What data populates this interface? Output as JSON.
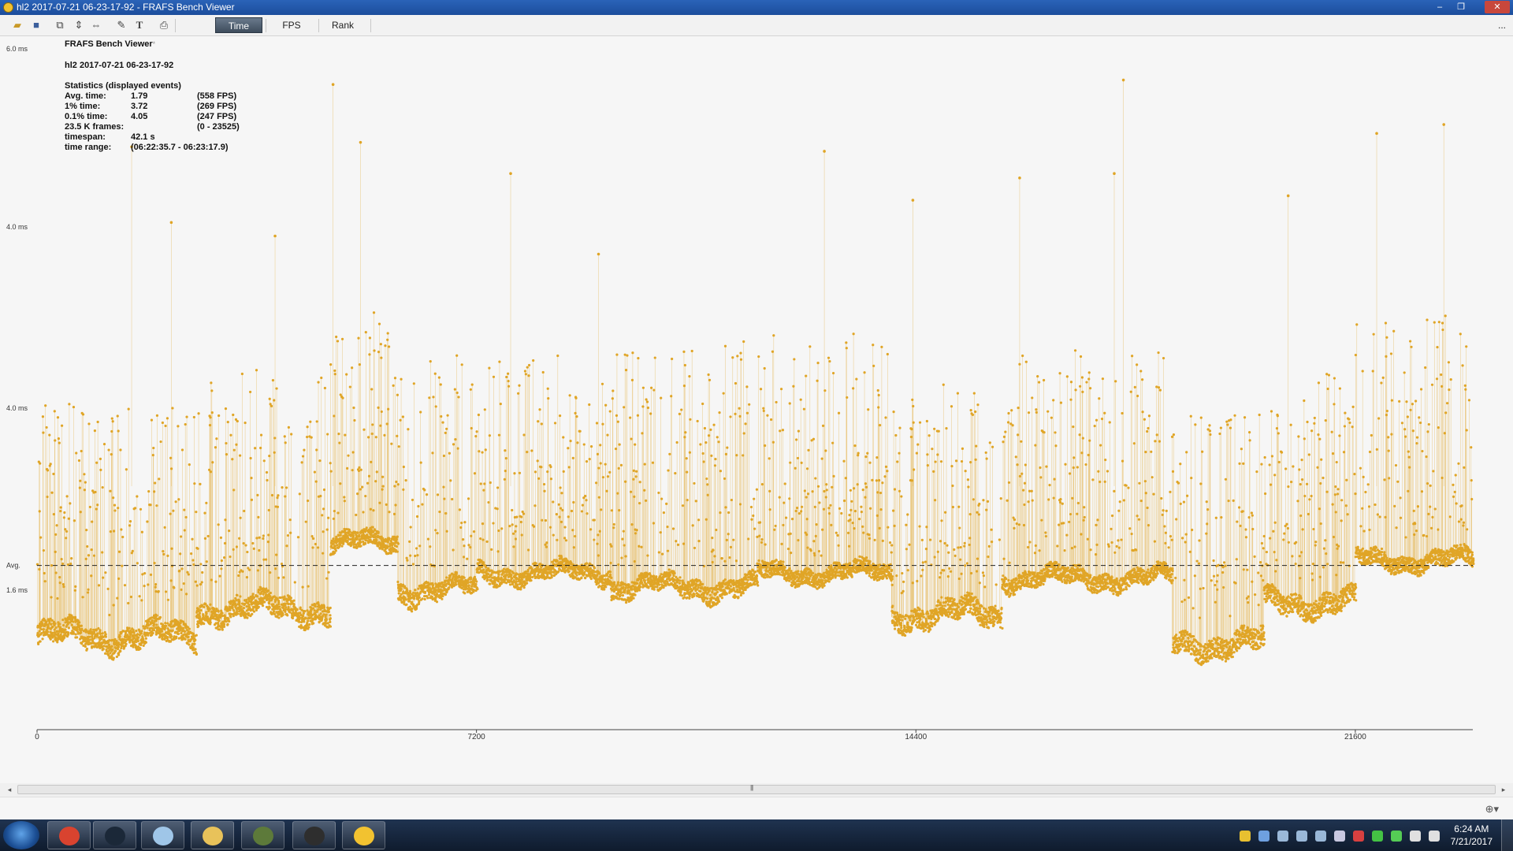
{
  "window": {
    "title": "hl2 2017-07-21 06-23-17-92 - FRAFS Bench Viewer",
    "controls": {
      "minimize": "–",
      "restore": "❐",
      "close": "✕"
    }
  },
  "toolbar": {
    "icons": [
      "open-folder-icon",
      "save-icon",
      "copy-icon",
      "fit-vertical-icon",
      "fit-horizontal-icon",
      "wrench-icon",
      "text-icon",
      "print-icon"
    ],
    "tabs": [
      {
        "label": "Time",
        "active": true
      },
      {
        "label": "FPS",
        "active": false
      },
      {
        "label": "Rank",
        "active": false
      }
    ],
    "overflow": "..."
  },
  "stats": {
    "app_name": "FRAFS Bench Viewer",
    "app_name_mark": "*",
    "file_name": "hl2 2017-07-21 06-23-17-92",
    "section_title": "Statistics (displayed events)",
    "rows": [
      {
        "label": "Avg. time:",
        "value": "1.79",
        "extra": "(558 FPS)"
      },
      {
        "label": "1% time:",
        "value": "3.72",
        "extra": "(269 FPS)"
      },
      {
        "label": "0.1% time:",
        "value": "4.05",
        "extra": "(247 FPS)"
      },
      {
        "label": "23.5 K frames:",
        "value": "",
        "extra": "(0 - 23525)"
      },
      {
        "label": "timespan:",
        "value": "42.1 s",
        "extra": ""
      },
      {
        "label": "time range:",
        "value": "(06:22:35.7 - 06:23:17.9)",
        "extra": ""
      }
    ]
  },
  "chart_data": {
    "type": "scatter",
    "title": "",
    "xlabel": "",
    "ylabel": "",
    "x_ticks": [
      0,
      7200,
      14400,
      21600
    ],
    "xlim": [
      0,
      23525
    ],
    "y_ticks": [
      {
        "label": "6.0 ms",
        "value": 6.0
      },
      {
        "label": "4.0 ms",
        "value": 4.0
      },
      {
        "label": "4.0 ms",
        "value": 3.0
      },
      {
        "label": "1.6 ms",
        "value": 1.6
      }
    ],
    "ylim": [
      0.8,
      6.0
    ],
    "avg_label": "Avg.",
    "avg_value": 1.79,
    "series": [
      {
        "color": "#e0a526",
        "segments": [
          {
            "x_start": 0,
            "x_end": 2600,
            "base": 1.32,
            "top": 3.0
          },
          {
            "x_start": 2600,
            "x_end": 4800,
            "base": 1.48,
            "top": 3.2
          },
          {
            "x_start": 4800,
            "x_end": 5900,
            "base": 1.95,
            "top": 3.5
          },
          {
            "x_start": 5900,
            "x_end": 7200,
            "base": 1.6,
            "top": 3.3
          },
          {
            "x_start": 7200,
            "x_end": 9400,
            "base": 1.72,
            "top": 3.3
          },
          {
            "x_start": 9400,
            "x_end": 11800,
            "base": 1.62,
            "top": 3.35
          },
          {
            "x_start": 11800,
            "x_end": 14000,
            "base": 1.72,
            "top": 3.4
          },
          {
            "x_start": 14000,
            "x_end": 15800,
            "base": 1.45,
            "top": 3.1
          },
          {
            "x_start": 15800,
            "x_end": 18600,
            "base": 1.68,
            "top": 3.3
          },
          {
            "x_start": 18600,
            "x_end": 20100,
            "base": 1.28,
            "top": 3.0
          },
          {
            "x_start": 20100,
            "x_end": 21600,
            "base": 1.52,
            "top": 3.2
          },
          {
            "x_start": 21600,
            "x_end": 23525,
            "base": 1.82,
            "top": 3.5
          }
        ],
        "spikes": [
          {
            "x": 1550,
            "y": 4.9
          },
          {
            "x": 2200,
            "y": 4.05
          },
          {
            "x": 3900,
            "y": 3.95
          },
          {
            "x": 4850,
            "y": 5.6
          },
          {
            "x": 5300,
            "y": 4.95
          },
          {
            "x": 7760,
            "y": 4.6
          },
          {
            "x": 9200,
            "y": 3.85
          },
          {
            "x": 12900,
            "y": 4.85
          },
          {
            "x": 14350,
            "y": 4.3
          },
          {
            "x": 16100,
            "y": 4.55
          },
          {
            "x": 17650,
            "y": 4.6
          },
          {
            "x": 17800,
            "y": 5.65
          },
          {
            "x": 20500,
            "y": 4.35
          },
          {
            "x": 21950,
            "y": 5.05
          },
          {
            "x": 23050,
            "y": 5.15
          }
        ]
      }
    ],
    "grid": false,
    "legend": "none"
  },
  "scrollbar": {
    "left_arrow": "◂",
    "right_arrow": "▸",
    "grip": "|||"
  },
  "taskbar": {
    "apps": [
      {
        "name": "chrome",
        "color": "#d9432f"
      },
      {
        "name": "steam",
        "color": "#1b2838"
      },
      {
        "name": "notepad",
        "color": "#9fc6e8"
      },
      {
        "name": "file-explorer",
        "color": "#e8c25a"
      },
      {
        "name": "frafs-bench-viewer",
        "color": "#5d7a3a"
      },
      {
        "name": "counter-strike",
        "color": "#2e2e2e"
      },
      {
        "name": "fraps-stopwatch",
        "color": "#f2c230"
      }
    ],
    "tray_icons": [
      "fraps-tray-icon",
      "network-globe-icon",
      "steam-tray-icon",
      "steam-tray-icon-2",
      "steam-tray-icon-3",
      "discord-icon",
      "security-shield-icon",
      "nvidia-icon",
      "xbox-icon",
      "network-icon",
      "volume-icon"
    ],
    "clock": {
      "time": "6:24 AM",
      "date": "7/21/2017"
    }
  }
}
